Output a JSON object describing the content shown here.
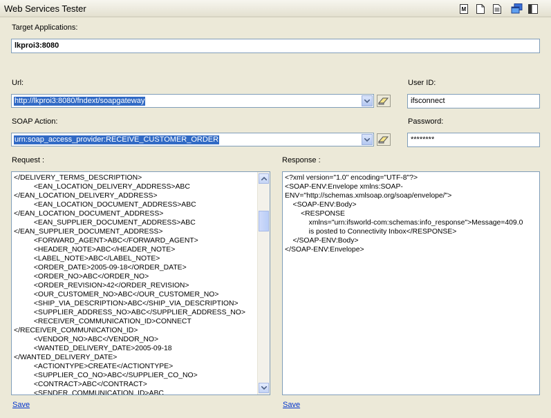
{
  "window": {
    "title": "Web Services Tester",
    "toolbar_icons": [
      "document-m-icon",
      "new-document-icon",
      "text-document-icon",
      "windows-icon",
      "split-view-icon"
    ]
  },
  "target": {
    "label": "Target Applications:",
    "value": "lkproi3:8080"
  },
  "url": {
    "label": "Url:",
    "value": "http://lkproi3:8080/fndext/soapgateway"
  },
  "soap_action": {
    "label": "SOAP Action:",
    "value": "urn:soap_access_provider:RECEIVE_CUSTOMER_ORDER"
  },
  "user": {
    "label": "User ID:",
    "value": "ifsconnect"
  },
  "password": {
    "label": "Password:",
    "value": "********"
  },
  "request": {
    "label": "Request :",
    "text": "</DELIVERY_TERMS_DESCRIPTION>\n          <EAN_LOCATION_DELIVERY_ADDRESS>ABC\n</EAN_LOCATION_DELIVERY_ADDRESS>\n          <EAN_LOCATION_DOCUMENT_ADDRESS>ABC\n</EAN_LOCATION_DOCUMENT_ADDRESS>\n          <EAN_SUPPLIER_DOCUMENT_ADDRESS>ABC\n</EAN_SUPPLIER_DOCUMENT_ADDRESS>\n          <FORWARD_AGENT>ABC</FORWARD_AGENT>\n          <HEADER_NOTE>ABC</HEADER_NOTE>\n          <LABEL_NOTE>ABC</LABEL_NOTE>\n          <ORDER_DATE>2005-09-18</ORDER_DATE>\n          <ORDER_NO>ABC</ORDER_NO>\n          <ORDER_REVISION>42</ORDER_REVISION>\n          <OUR_CUSTOMER_NO>ABC</OUR_CUSTOMER_NO>\n          <SHIP_VIA_DESCRIPTION>ABC</SHIP_VIA_DESCRIPTION>\n          <SUPPLIER_ADDRESS_NO>ABC</SUPPLIER_ADDRESS_NO>\n          <RECEIVER_COMMUNICATION_ID>CONNECT\n</RECEIVER_COMMUNICATION_ID>\n          <VENDOR_NO>ABC</VENDOR_NO>\n          <WANTED_DELIVERY_DATE>2005-09-18\n</WANTED_DELIVERY_DATE>\n          <ACTIONTYPE>CREATE</ACTIONTYPE>\n          <SUPPLIER_CO_NO>ABC</SUPPLIER_CO_NO>\n          <CONTRACT>ABC</CONTRACT>\n          <SENDER_COMMUNICATION_ID>ABC",
    "save_label": "Save"
  },
  "response": {
    "label": "Response :",
    "text": "<?xml version=\"1.0\" encoding=\"UTF-8\"?>\n<SOAP-ENV:Envelope xmlns:SOAP-\nENV=\"http://schemas.xmlsoap.org/soap/envelope/\">\n    <SOAP-ENV:Body>\n        <RESPONSE\n            xmlns=\"urn:ifsworld-com:schemas:info_response\">Message=409.0\n            is posted to Connectivity Inbox</RESPONSE>\n    </SOAP-ENV:Body>\n</SOAP-ENV:Envelope>",
    "save_label": "Save"
  }
}
